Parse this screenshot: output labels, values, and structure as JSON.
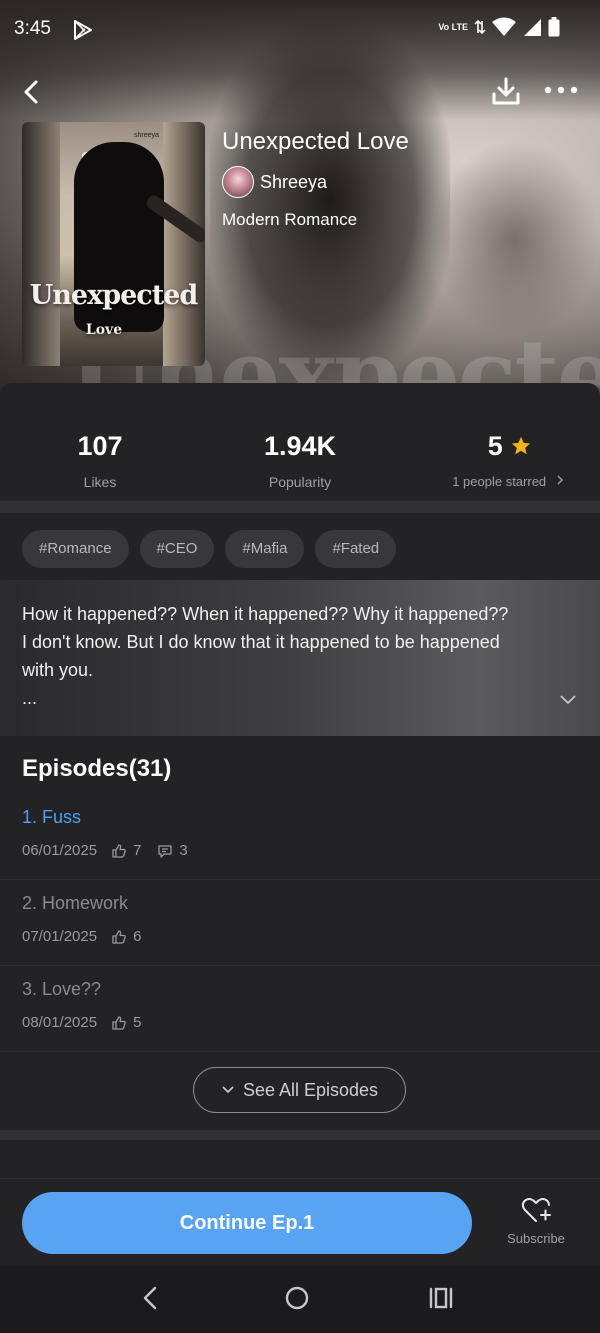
{
  "status_bar": {
    "time": "3:45",
    "network_label": "Vo LTE"
  },
  "story": {
    "title": "Unexpected Love",
    "author": "Shreeya",
    "genre": "Modern Romance",
    "cover": {
      "title_line1": "Unexpected",
      "title_line2": "Love",
      "brand": "shreeya"
    },
    "hero_watermark": "Unexpected"
  },
  "stats": {
    "likes": {
      "value": "107",
      "label": "Likes"
    },
    "popularity": {
      "value": "1.94K",
      "label": "Popularity"
    },
    "rating": {
      "value": "5",
      "label": "1 people starred"
    }
  },
  "tags": [
    "#Romance",
    "#CEO",
    "#Mafia",
    "#Fated"
  ],
  "synopsis": {
    "line1": "How it happened?? When it happened?? Why it happened??",
    "line2": "I don't know. But I do know that it happened to be happened",
    "line3": "with you.",
    "ellipsis": "..."
  },
  "episodes": {
    "heading": "Episodes(31)",
    "items": [
      {
        "name": "1. Fuss",
        "date": "06/01/2025",
        "likes": "7",
        "comments": "3",
        "active": true
      },
      {
        "name": "2. Homework",
        "date": "07/01/2025",
        "likes": "6"
      },
      {
        "name": "3. Love??",
        "date": "08/01/2025",
        "likes": "5"
      }
    ],
    "see_all_label": "See All Episodes"
  },
  "actions": {
    "continue_label": "Continue Ep.1",
    "subscribe_label": "Subscribe"
  },
  "colors": {
    "accent": "#59a4f2",
    "active_episode": "#4e9ff0",
    "star": "#f5b21c",
    "background": "#232325"
  },
  "icons": [
    "back-arrow-icon",
    "download-icon",
    "more-icon",
    "star-icon",
    "thumbs-up-icon",
    "comment-icon",
    "chevron-down-icon",
    "heart-plus-icon",
    "play-store-icon"
  ]
}
